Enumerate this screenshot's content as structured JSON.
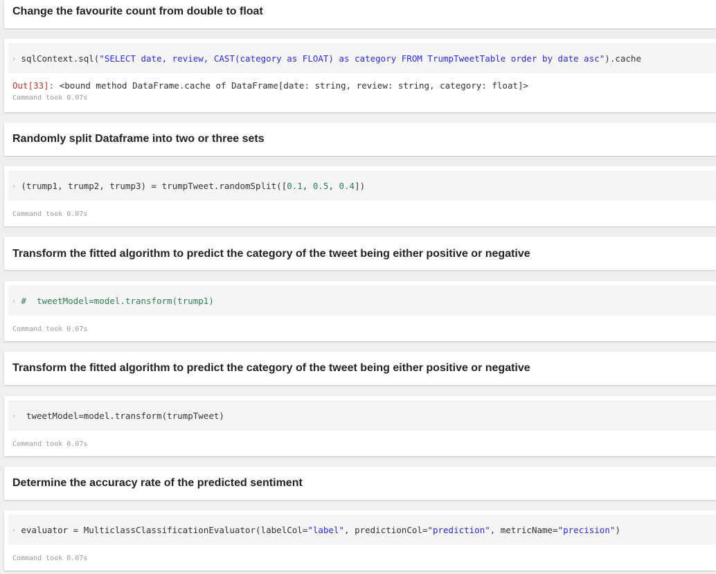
{
  "cells": [
    {
      "type": "markdown",
      "title": "Change the favourite count from double to float"
    },
    {
      "type": "code",
      "prompt_icon": "›",
      "code_tokens": [
        {
          "t": "sqlContext.sql(",
          "c": "plain"
        },
        {
          "t": "\"SELECT date, review, CAST(category as FLOAT) as category FROM TrumpTweetTable order by date asc\"",
          "c": "str"
        },
        {
          "t": ").cache",
          "c": "plain"
        }
      ],
      "output_prompt": "Out[33]:",
      "output_text": " <bound method DataFrame.cache of DataFrame[date: string, review: string, category: float]>",
      "status": "Command took 0.07s"
    },
    {
      "type": "markdown",
      "title": "Randomly split Dataframe into two or three sets"
    },
    {
      "type": "code",
      "prompt_icon": "›",
      "code_tokens": [
        {
          "t": "(trump1, trump2, trump3) = trumpTweet.randomSplit([",
          "c": "plain"
        },
        {
          "t": "0.1",
          "c": "num"
        },
        {
          "t": ", ",
          "c": "plain"
        },
        {
          "t": "0.5",
          "c": "num"
        },
        {
          "t": ", ",
          "c": "plain"
        },
        {
          "t": "0.4",
          "c": "num"
        },
        {
          "t": "])",
          "c": "plain"
        }
      ],
      "status": "Command took 0.07s"
    },
    {
      "type": "markdown",
      "title": "Transform the fitted algorithm to predict the category of the tweet being either positive or negative"
    },
    {
      "type": "code",
      "prompt_icon": "›",
      "code_tokens": [
        {
          "t": "#  tweetModel=model.transform(trump1)",
          "c": "comment"
        }
      ],
      "status": "Command took 0.07s"
    },
    {
      "type": "markdown",
      "title": "Transform the fitted algorithm to predict the category of the tweet being either positive or negative"
    },
    {
      "type": "code",
      "prompt_icon": "›",
      "code_tokens": [
        {
          "t": " tweetModel=model.transform(trumpTweet)",
          "c": "plain"
        }
      ],
      "status": "Command took 0.07s"
    },
    {
      "type": "markdown",
      "title": "Determine the accuracy rate of the predicted sentiment"
    },
    {
      "type": "code",
      "prompt_icon": "›",
      "code_tokens": [
        {
          "t": "evaluator = MulticlassClassificationEvaluator(labelCol=",
          "c": "plain"
        },
        {
          "t": "\"label\"",
          "c": "str"
        },
        {
          "t": ", predictionCol=",
          "c": "plain"
        },
        {
          "t": "\"prediction\"",
          "c": "str"
        },
        {
          "t": ", metricName=",
          "c": "plain"
        },
        {
          "t": "\"precision\"",
          "c": "str"
        },
        {
          "t": ")",
          "c": "plain"
        }
      ],
      "status": "Command took 0.07s"
    }
  ],
  "colors": {
    "string": "#2b2bd4",
    "number": "#2e7d5a",
    "comment": "#2e7d5a",
    "out_prompt": "#b03a2e",
    "status": "#9a9a9a"
  }
}
